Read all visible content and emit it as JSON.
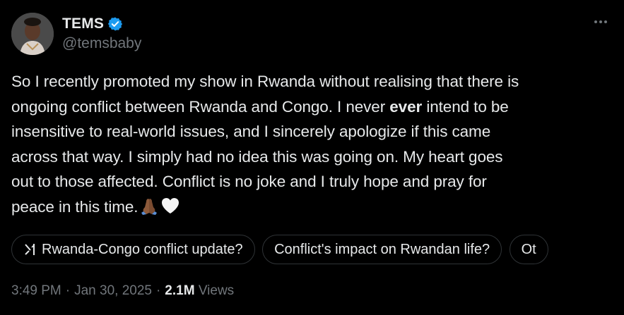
{
  "author": {
    "display_name": "TEMS",
    "handle": "@temsbaby",
    "verified": true,
    "avatar_icon": "profile-photo"
  },
  "tweet": {
    "lines": [
      [
        "So I recently promoted my show in Rwanda without realising that there is"
      ],
      [
        "ongoing conflict between Rwanda and Congo. I never ",
        "ever",
        " intend to be"
      ],
      [
        "insensitive to real-world issues, and I sincerely apologize if this came"
      ],
      [
        "across that way. I simply had no idea this was going on. My heart goes"
      ],
      [
        "out to those affected. Conflict is no joke and I truly hope and pray for"
      ],
      [
        "peace in this time."
      ]
    ],
    "emoji": [
      "folded-hands-emoji",
      "white-heart-emoji"
    ]
  },
  "grok_chips": [
    {
      "label": "Rwanda-Congo conflict update?",
      "icon": "grok-icon"
    },
    {
      "label": "Conflict's impact on Rwandan life?"
    },
    {
      "label": "Ot"
    }
  ],
  "meta": {
    "time": "3:49 PM",
    "dot1": "·",
    "date": "Jan 30, 2025",
    "dot2": "·",
    "views_count": "2.1M",
    "views_label": "Views"
  },
  "colors": {
    "background": "#000000",
    "text": "#e7e9ea",
    "muted": "#71767b",
    "verified_blue": "#1d9bf0",
    "chip_border": "#2f3336"
  }
}
